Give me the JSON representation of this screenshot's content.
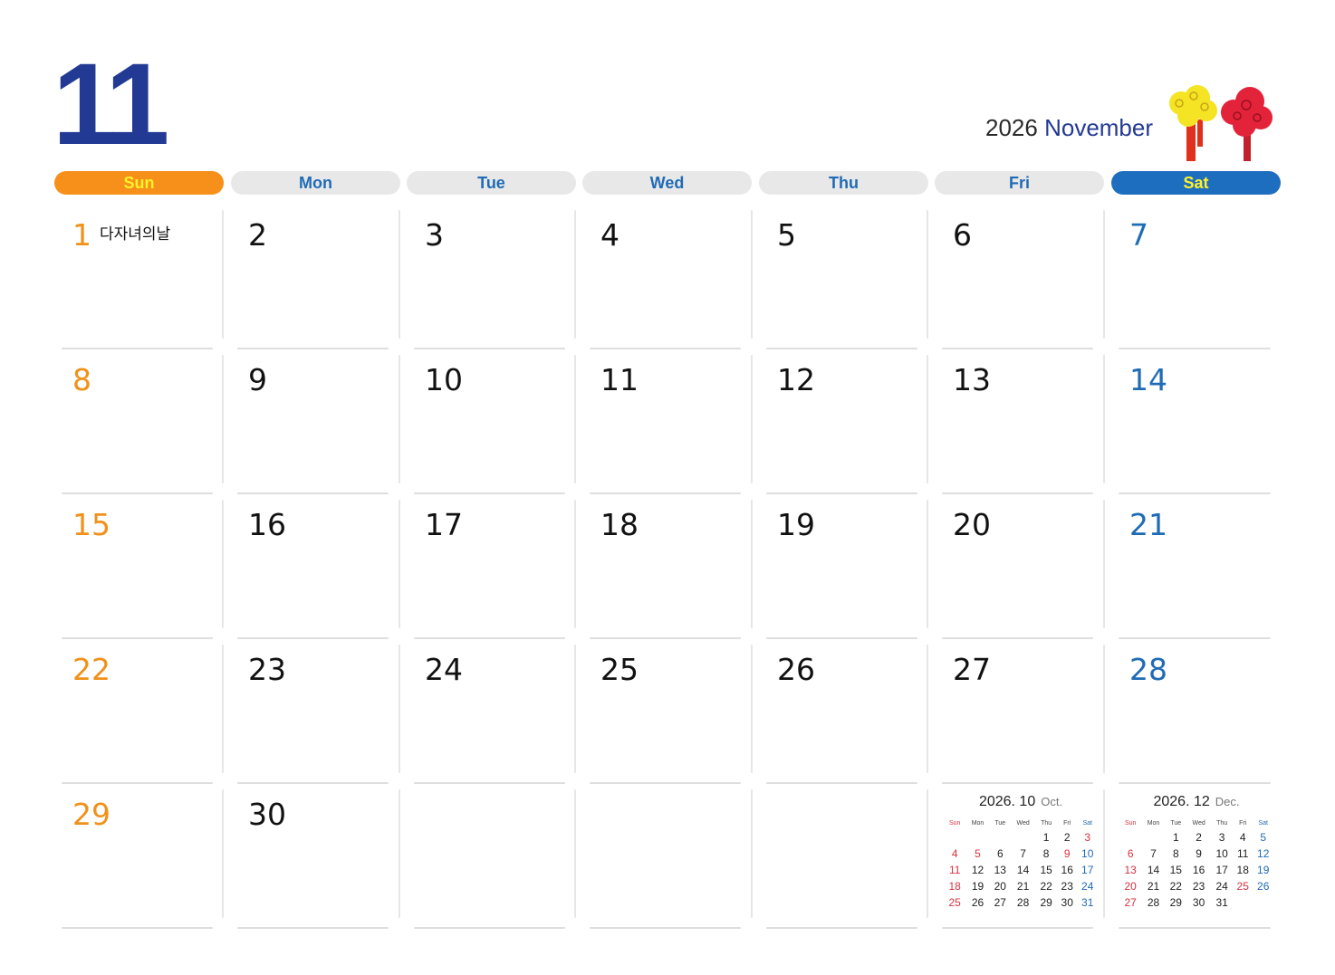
{
  "header": {
    "month_number": "11",
    "year": "2026",
    "month_name": "November"
  },
  "weekdays": [
    "Sun",
    "Mon",
    "Tue",
    "Wed",
    "Thu",
    "Fri",
    "Sat"
  ],
  "colors": {
    "accent": "#233a94",
    "sunday": "#f0911a",
    "saturday": "#1f6bb6",
    "header_sun_bg": "#f6901a",
    "header_sun_text": "#fff22a",
    "header_sat_bg": "#1e6ec0",
    "header_sat_text": "#fff22a",
    "header_weekday_bg": "#e8e8e8",
    "header_weekday_text": "#1f6bb6",
    "holiday_red": "#d93140"
  },
  "weeks": [
    [
      "1",
      "2",
      "3",
      "4",
      "5",
      "6",
      "7"
    ],
    [
      "8",
      "9",
      "10",
      "11",
      "12",
      "13",
      "14"
    ],
    [
      "15",
      "16",
      "17",
      "18",
      "19",
      "20",
      "21"
    ],
    [
      "22",
      "23",
      "24",
      "25",
      "26",
      "27",
      "28"
    ],
    [
      "29",
      "30",
      "",
      "",
      "",
      "",
      ""
    ]
  ],
  "holidays": {
    "1": "다자녀의날"
  },
  "mini_calendars": [
    {
      "title": "2026. 10",
      "title_en": "Oct.",
      "weekdays": [
        "Sun",
        "Mon",
        "Tue",
        "Wed",
        "Thu",
        "Fri",
        "Sat"
      ],
      "weeks": [
        [
          "",
          "",
          "",
          "",
          "1",
          "2",
          "3"
        ],
        [
          "4",
          "5",
          "6",
          "7",
          "8",
          "9",
          "10"
        ],
        [
          "11",
          "12",
          "13",
          "14",
          "15",
          "16",
          "17"
        ],
        [
          "18",
          "19",
          "20",
          "21",
          "22",
          "23",
          "24"
        ],
        [
          "25",
          "26",
          "27",
          "28",
          "29",
          "30",
          "31"
        ]
      ],
      "red_days": [
        "3",
        "4",
        "5",
        "9",
        "11",
        "18",
        "25"
      ],
      "blue_days": [
        "10",
        "17",
        "24",
        "31"
      ]
    },
    {
      "title": "2026. 12",
      "title_en": "Dec.",
      "weekdays": [
        "Sun",
        "Mon",
        "Tue",
        "Wed",
        "Thu",
        "Fri",
        "Sat"
      ],
      "weeks": [
        [
          "",
          "",
          "1",
          "2",
          "3",
          "4",
          "5"
        ],
        [
          "6",
          "7",
          "8",
          "9",
          "10",
          "11",
          "12"
        ],
        [
          "13",
          "14",
          "15",
          "16",
          "17",
          "18",
          "19"
        ],
        [
          "20",
          "21",
          "22",
          "23",
          "24",
          "25",
          "26"
        ],
        [
          "27",
          "28",
          "29",
          "30",
          "31",
          "",
          ""
        ]
      ],
      "red_days": [
        "6",
        "13",
        "20",
        "25",
        "27"
      ],
      "blue_days": [
        "5",
        "12",
        "19",
        "26"
      ]
    }
  ]
}
